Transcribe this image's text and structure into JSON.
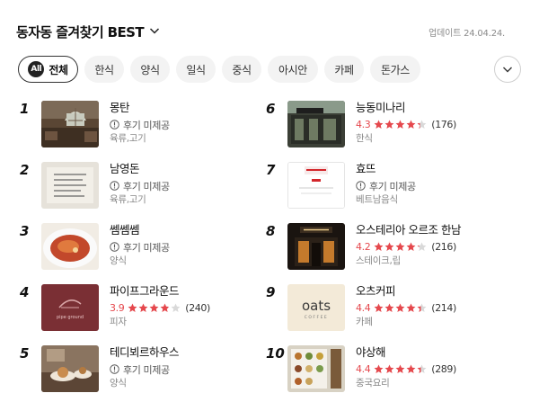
{
  "header": {
    "title": "동자동 즐겨찾기 BEST",
    "updated": "업데이트 24.04.24."
  },
  "chips": [
    {
      "label": "전체",
      "badge": "All",
      "active": true
    },
    {
      "label": "한식"
    },
    {
      "label": "양식"
    },
    {
      "label": "일식"
    },
    {
      "label": "중식"
    },
    {
      "label": "아시안"
    },
    {
      "label": "카페"
    },
    {
      "label": "돈가스"
    }
  ],
  "colors": {
    "rating": "#e5484d",
    "star": "#e5484d",
    "star_empty": "#d9d9d9",
    "accent": "#222222"
  },
  "items": [
    {
      "rank": "1",
      "name": "몽탄",
      "no_review": "후기 미제공",
      "category": "육류,고기",
      "thumb_icon": "restaurant-interior"
    },
    {
      "rank": "2",
      "name": "남영돈",
      "no_review": "후기 미제공",
      "category": "육류,고기",
      "thumb_icon": "menu-board"
    },
    {
      "rank": "3",
      "name": "쎔쎔쎔",
      "no_review": "후기 미제공",
      "category": "양식",
      "thumb_icon": "pasta-dish"
    },
    {
      "rank": "4",
      "name": "파이프그라운드",
      "rating": "3.9",
      "stars": 3.9,
      "count": "(240)",
      "category": "피자",
      "thumb_icon": "pipe-ground-logo"
    },
    {
      "rank": "5",
      "name": "테디뵈르하우스",
      "no_review": "후기 미제공",
      "category": "양식",
      "thumb_icon": "bakery-interior"
    },
    {
      "rank": "6",
      "name": "능동미나리",
      "rating": "4.3",
      "stars": 4.3,
      "count": "(176)",
      "category": "한식",
      "thumb_icon": "storefront"
    },
    {
      "rank": "7",
      "name": "효뜨",
      "no_review": "후기 미제공",
      "category": "베트남음식",
      "thumb_icon": "lunch-menu"
    },
    {
      "rank": "8",
      "name": "오스테리아 오르조 한남",
      "rating": "4.2",
      "stars": 4.2,
      "count": "(216)",
      "category": "스테이크,립",
      "thumb_icon": "night-storefront"
    },
    {
      "rank": "9",
      "name": "오츠커피",
      "rating": "4.4",
      "stars": 4.4,
      "count": "(214)",
      "category": "카페",
      "thumb_icon": "oats-coffee-logo"
    },
    {
      "rank": "10",
      "name": "야상해",
      "rating": "4.4",
      "stars": 4.4,
      "count": "(289)",
      "category": "중국요리",
      "thumb_icon": "menu-wall"
    }
  ]
}
